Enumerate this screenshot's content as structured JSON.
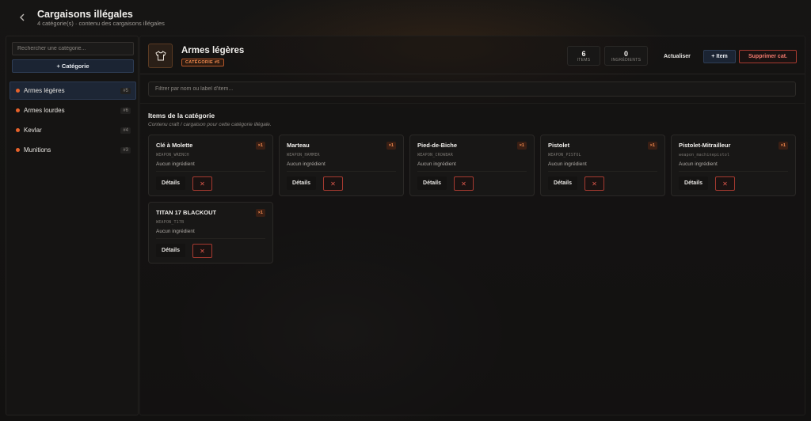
{
  "header": {
    "back_icon": "chevron-left-icon",
    "title": "Cargaisons illégales",
    "subtitle": "4 catégorie(s) · contenu des cargaisons illégales"
  },
  "sidebar": {
    "search_placeholder": "Rechercher une catégorie...",
    "add_category_label": "+ Catégorie",
    "categories": [
      {
        "label": "Armes légères",
        "count": "#5",
        "active": true
      },
      {
        "label": "Armes lourdes",
        "count": "#6",
        "active": false
      },
      {
        "label": "Kevlar",
        "count": "#4",
        "active": false
      },
      {
        "label": "Munitions",
        "count": "#3",
        "active": false
      }
    ]
  },
  "main": {
    "category_icon": "shirt-icon",
    "title": "Armes légères",
    "badge": "CATÉGORIE #5",
    "stats": {
      "items_value": "6",
      "items_label": "ITEMS",
      "ingredients_value": "0",
      "ingredients_label": "INGRÉDIENTS"
    },
    "refresh_label": "Actualiser",
    "add_item_label": "+ Item",
    "delete_category_label": "Supprimer cat.",
    "filter_placeholder": "Filtrer par nom ou label d'item...",
    "section_title": "Items de la catégorie",
    "section_subtitle": "Contenu craft / cargaison pour cette catégorie illégale.",
    "details_label": "Détails",
    "delete_icon": "close-icon",
    "items": [
      {
        "name": "Clé à Molette",
        "qty": "×1",
        "code": "WEAPON_WRENCH",
        "ingredients": "Aucun ingrédient"
      },
      {
        "name": "Marteau",
        "qty": "×1",
        "code": "WEAPON_HAMMER",
        "ingredients": "Aucun ingrédient"
      },
      {
        "name": "Pied-de-Biche",
        "qty": "×1",
        "code": "WEAPON_CROWBAR",
        "ingredients": "Aucun ingrédient"
      },
      {
        "name": "Pistolet",
        "qty": "×1",
        "code": "WEAPON_PISTOL",
        "ingredients": "Aucun ingrédient"
      },
      {
        "name": "Pistolet-Mitrailleur",
        "qty": "×1",
        "code": "weapon_machinepistol",
        "ingredients": "Aucun ingrédient"
      },
      {
        "name": "TITAN 17 BLACKOUT",
        "qty": "×1",
        "code": "WEAPON_T17B",
        "ingredients": "Aucun ingrédient"
      }
    ]
  },
  "colors": {
    "accent": "#e8622b",
    "danger": "#a63a30",
    "primary_button": "#1b2433"
  }
}
